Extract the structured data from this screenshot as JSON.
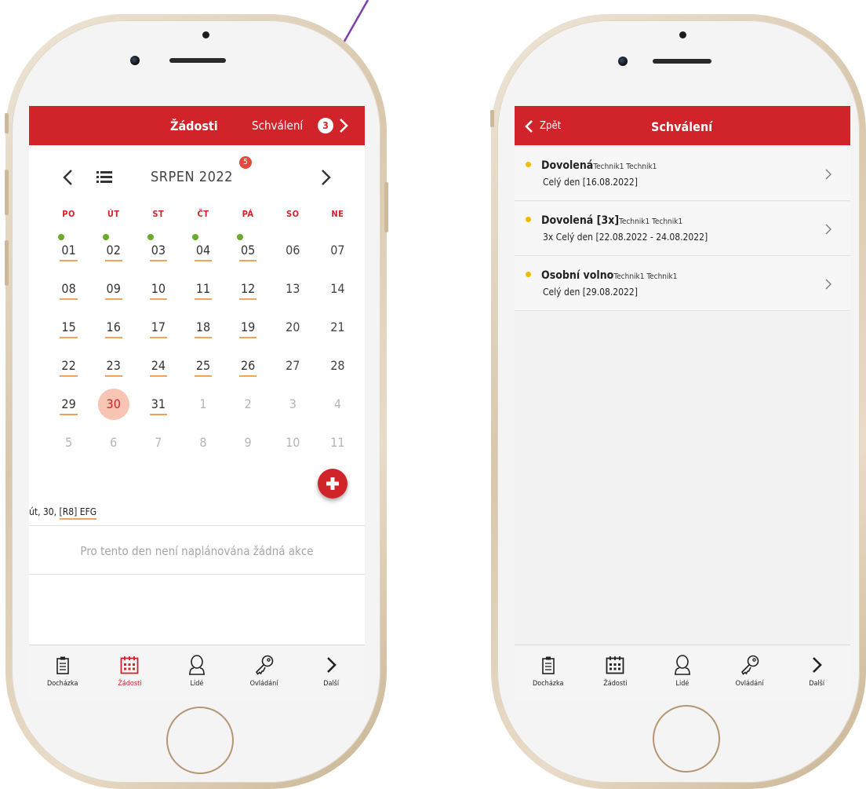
{
  "left": {
    "header": {
      "title": "Žádosti",
      "approvals_label": "Schválení",
      "approvals_count": "3"
    },
    "calendar": {
      "month_title": "SRPEN 2022",
      "month_badge": "5",
      "weekdays": [
        "PO",
        "ÚT",
        "ST",
        "ČT",
        "PÁ",
        "SO",
        "NE"
      ],
      "weeks": [
        [
          "01",
          "02",
          "03",
          "04",
          "05",
          "06",
          "07"
        ],
        [
          "08",
          "09",
          "10",
          "11",
          "12",
          "13",
          "14"
        ],
        [
          "15",
          "16",
          "17",
          "18",
          "19",
          "20",
          "21"
        ],
        [
          "22",
          "23",
          "24",
          "25",
          "26",
          "27",
          "28"
        ],
        [
          "29",
          "30",
          "31",
          "1",
          "2",
          "3",
          "4"
        ],
        [
          "5",
          "6",
          "7",
          "8",
          "9",
          "10",
          "11"
        ]
      ]
    },
    "day_label": "út, 30,",
    "shift_code": "[R8] EFG",
    "empty_message": "Pro tento den není naplánována žádná akce"
  },
  "tabs": {
    "dochazka": "Docházka",
    "zadosti": "Žádosti",
    "lide": "Lidé",
    "ovladani": "Ovládání",
    "dalsi": "Další"
  },
  "right": {
    "header": {
      "back_label": "Zpět",
      "title": "Schválení"
    },
    "items": [
      {
        "type": "Dovolená",
        "person": "Technik1 Technik1",
        "detail": "Celý den [16.08.2022]"
      },
      {
        "type": "Dovolená [3x]",
        "person": "Technik1 Technik1",
        "detail": "3x Celý den [22.08.2022 - 24.08.2022]"
      },
      {
        "type": "Osobní volno",
        "person": "Technik1 Technik1",
        "detail": "Celý den [29.08.2022]"
      }
    ]
  },
  "colors": {
    "brand_red": "#d1232a",
    "accent_orange": "#f0a45c",
    "event_green": "#6aab2a",
    "today_pink": "#f8c4b4",
    "arrow_purple": "#7b3fb0"
  }
}
